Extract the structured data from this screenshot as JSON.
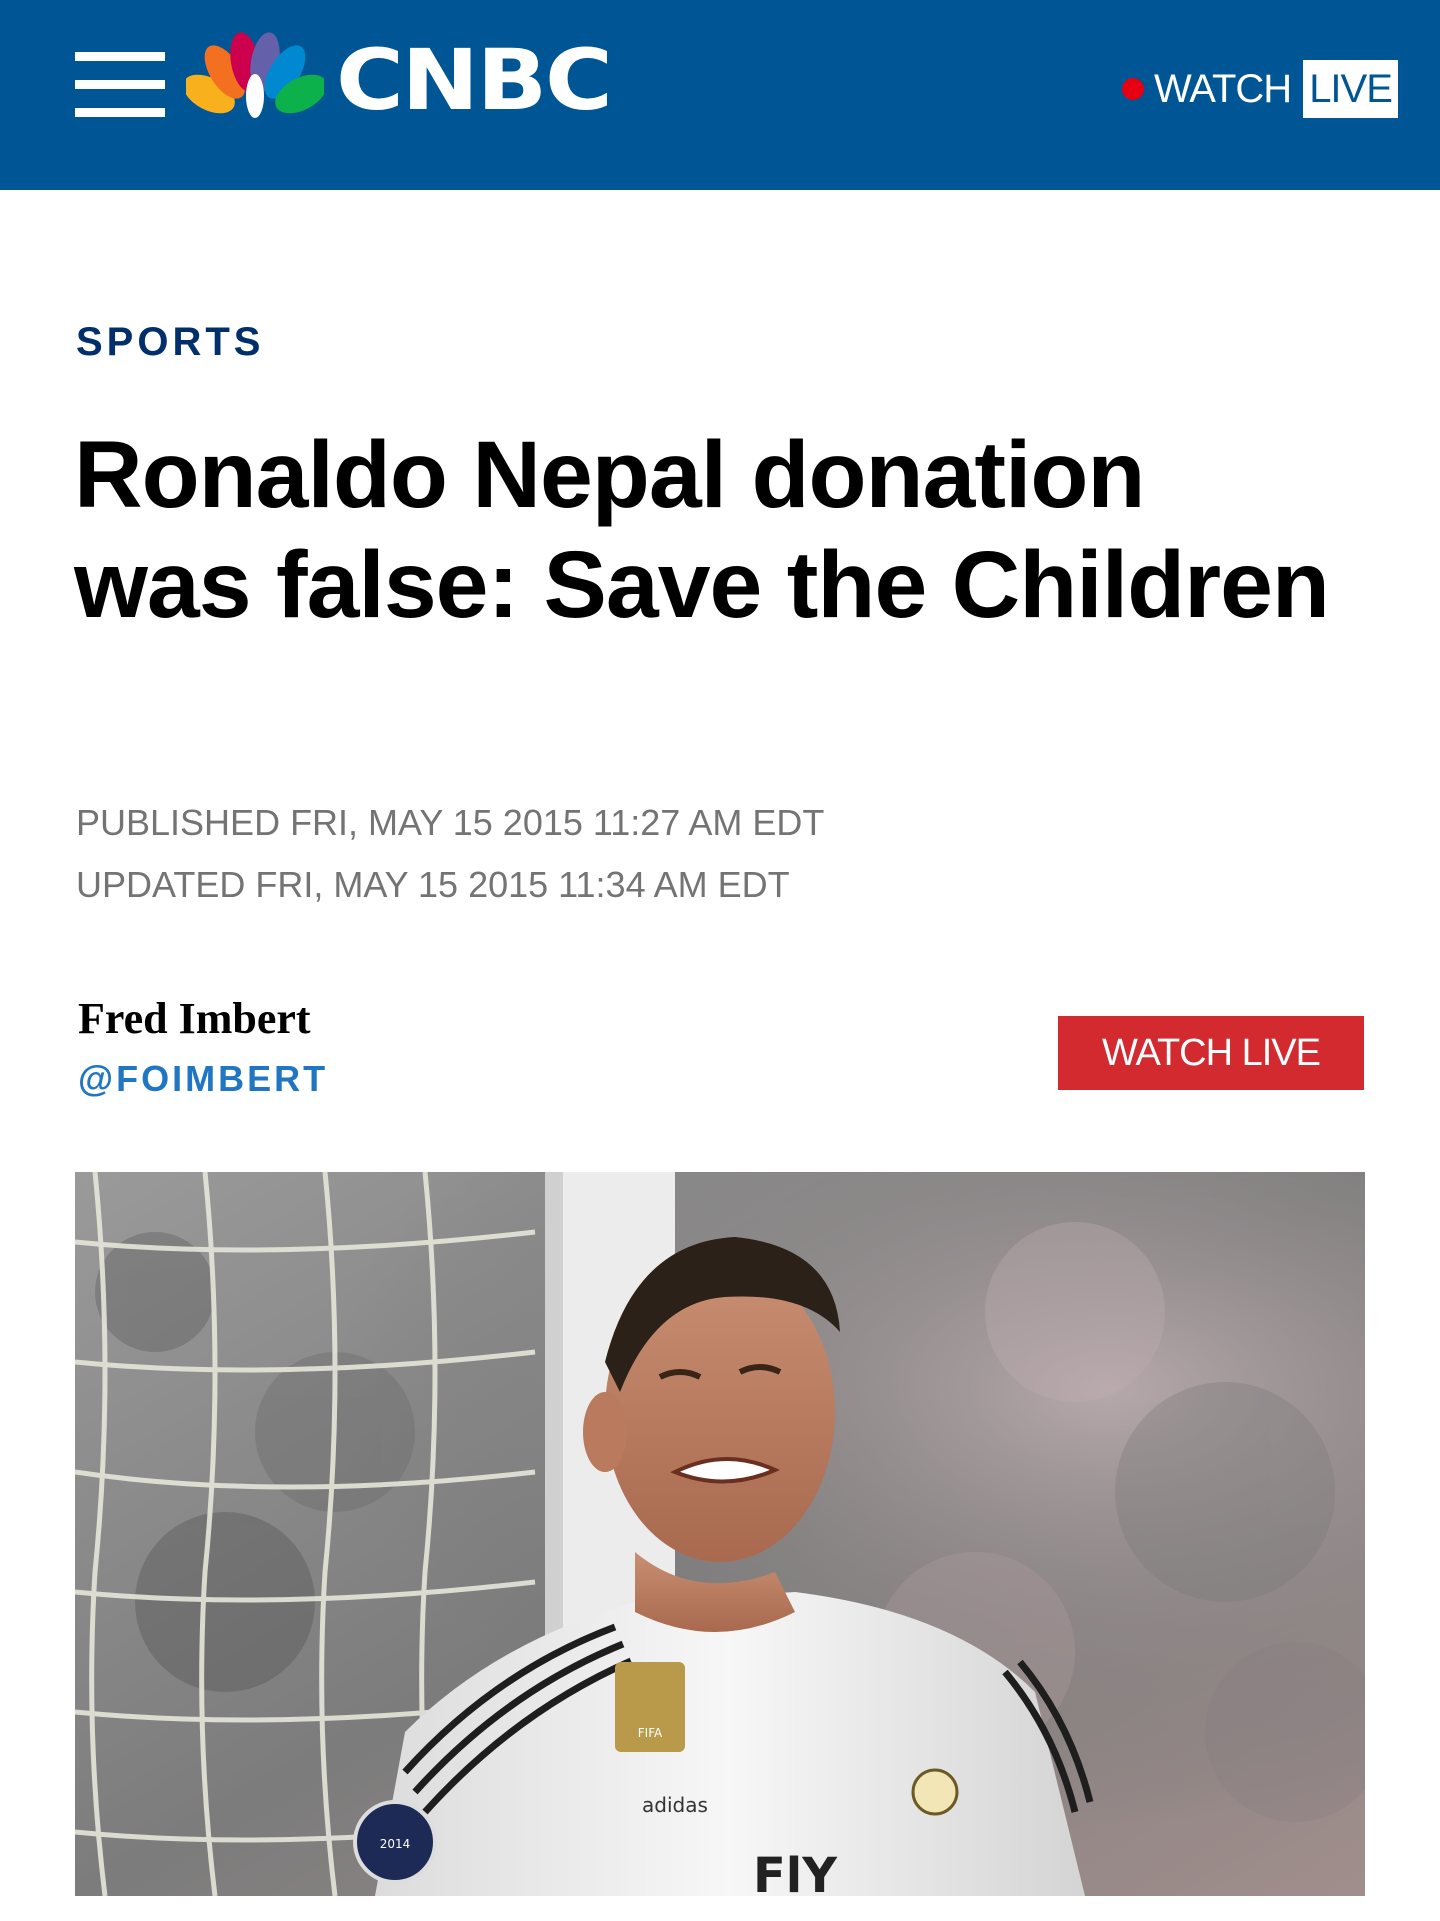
{
  "header": {
    "brand": "CNBC",
    "watch_label": "WATCH",
    "live_label": "LIVE"
  },
  "article": {
    "section": "SPORTS",
    "headline": "Ronaldo Nepal donation was false: Save the Children",
    "published": "PUBLISHED FRI, MAY 15 2015 11:27 AM EDT",
    "updated": "UPDATED FRI, MAY 15 2015 11:34 AM EDT",
    "author_name": "Fred Imbert",
    "author_handle": "@FOIMBERT",
    "watch_live_button": "WATCH LIVE"
  },
  "hero": {
    "jersey_brand": "adidas",
    "jersey_badge": "FIFA",
    "sleeve_badge": "2014",
    "shirt_text": "FlY"
  },
  "colors": {
    "header_bg": "#005594",
    "section_label": "#002f6c",
    "handle": "#2176c3",
    "live_button": "#d22a2e",
    "live_dot": "#e60012"
  }
}
